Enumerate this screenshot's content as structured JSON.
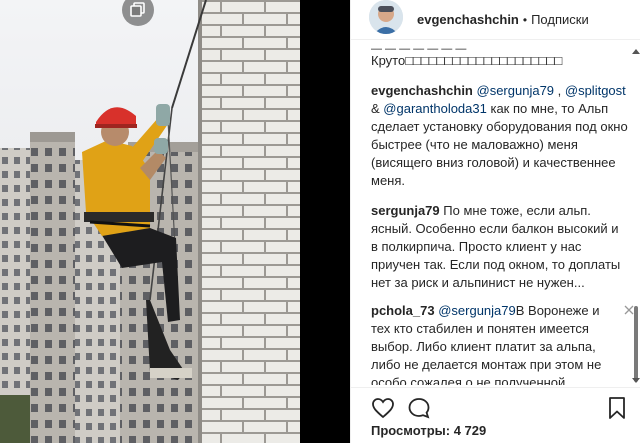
{
  "post": {
    "author": "evgenchashchin",
    "separator": "•",
    "follow_label": "Подписки",
    "views_label": "Просмотры:",
    "views_count": "4 729"
  },
  "comments": [
    {
      "clipped_text": "— — — — — — —",
      "text": "Круто□□□□□□□□□□□□□□□□□□□□"
    },
    {
      "user": "evgenchashchin",
      "mentions": [
        "@sergunja79",
        "@splitgost",
        "@garantholoda31"
      ],
      "sep1": " , ",
      "sep2": " & ",
      "text": " как по мне, то Альп сделает установку оборудования под окно быстрее (что не маловажно) меня (висящего вниз головой) и качественнее меня."
    },
    {
      "user": "sergunja79",
      "text": " По мне тоже, если альп. ясный. Особенно если балкон высокий и в полкирпича. Просто клиент у нас приучен так. Если под окном, то доплаты нет за риск и альпинист не нужен..."
    },
    {
      "user": "pchola_73",
      "mention": "@sergunja79",
      "text": "В Воронеже и тех кто стабилен и понятен имеется выбор. Либо клиент платит за альпа, либо не делается монтаж при этом не особо сожалея о не полученной прибыли. Покупатель услуги понимает, что цена работы высотника, это его собственный"
    }
  ],
  "icons": {
    "multi": "multiple-posts-icon",
    "like": "heart-icon",
    "comment": "comment-icon",
    "save": "bookmark-icon",
    "close": "close-icon"
  }
}
